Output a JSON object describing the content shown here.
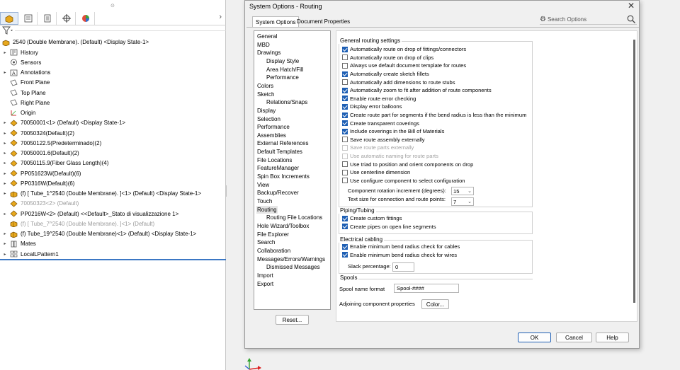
{
  "tree": {
    "root_label": "2540 (Double Membrane). (Default) <Display State-1>",
    "items": [
      {
        "label": "History",
        "expand": "▸",
        "icon": "history-icon",
        "suppressed": false
      },
      {
        "label": "Sensors",
        "expand": "",
        "icon": "sensor-icon",
        "suppressed": false
      },
      {
        "label": "Annotations",
        "expand": "▸",
        "icon": "annotation-icon",
        "suppressed": false
      },
      {
        "label": "Front Plane",
        "expand": "",
        "icon": "plane-icon",
        "suppressed": false
      },
      {
        "label": "Top Plane",
        "expand": "",
        "icon": "plane-icon",
        "suppressed": false
      },
      {
        "label": "Right Plane",
        "expand": "",
        "icon": "plane-icon",
        "suppressed": false
      },
      {
        "label": "Origin",
        "expand": "",
        "icon": "origin-icon",
        "suppressed": false
      },
      {
        "label": "70050001<1> (Default) <Display State-1>",
        "expand": "▸",
        "icon": "part-icon",
        "suppressed": false
      },
      {
        "label": "70050324(Default)(2)",
        "expand": "▸",
        "icon": "part-icon",
        "suppressed": false
      },
      {
        "label": "70050122.5(Predeterminado)(2)",
        "expand": "▸",
        "icon": "part-icon",
        "suppressed": false
      },
      {
        "label": "70050001.6(Default)(2)",
        "expand": "▸",
        "icon": "part-icon",
        "suppressed": false
      },
      {
        "label": "70050115.9(Fiber Glass Length)(4)",
        "expand": "▸",
        "icon": "part-icon",
        "suppressed": false
      },
      {
        "label": "PP051623W(Default)(6)",
        "expand": "▸",
        "icon": "part-icon",
        "suppressed": false
      },
      {
        "label": "PP0316W(Default)(6)",
        "expand": "▸",
        "icon": "part-icon",
        "suppressed": false
      },
      {
        "label": "(f) [ Tube_1^2540 (Double Membrane). ]<1> (Default) <Display State-1>",
        "expand": "▸",
        "icon": "subassembly-icon",
        "suppressed": false
      },
      {
        "label": "70050323<2> (Default)",
        "expand": "",
        "icon": "part-icon",
        "suppressed": true
      },
      {
        "label": "PP0216W<2> (Default) <<Default>_Stato di visualizzazione 1>",
        "expand": "▸",
        "icon": "part-icon",
        "suppressed": false
      },
      {
        "label": "(f) [ Tube_7^2540 (Double Membrane). ]<1> (Default)",
        "expand": "",
        "icon": "subassembly-icon",
        "suppressed": true
      },
      {
        "label": "(f) Tube_19^2540 (Double Membrane)<1> (Default) <Display State-1>",
        "expand": "▸",
        "icon": "subassembly-icon",
        "suppressed": false
      },
      {
        "label": "Mates",
        "expand": "▸",
        "icon": "mates-icon",
        "suppressed": false
      },
      {
        "label": "LocalLPattern1",
        "expand": "▸",
        "icon": "pattern-icon",
        "suppressed": false
      }
    ]
  },
  "dialog": {
    "title": "System Options - Routing",
    "tabs": [
      "System Options",
      "Document Properties"
    ],
    "search_placeholder": "Search Options",
    "categories": [
      {
        "label": "General",
        "sub": false,
        "selected": false
      },
      {
        "label": "MBD",
        "sub": false,
        "selected": false
      },
      {
        "label": "Drawings",
        "sub": false,
        "selected": false
      },
      {
        "label": "Display Style",
        "sub": true,
        "selected": false
      },
      {
        "label": "Area Hatch/Fill",
        "sub": true,
        "selected": false
      },
      {
        "label": "Performance",
        "sub": true,
        "selected": false
      },
      {
        "label": "Colors",
        "sub": false,
        "selected": false
      },
      {
        "label": "Sketch",
        "sub": false,
        "selected": false
      },
      {
        "label": "Relations/Snaps",
        "sub": true,
        "selected": false
      },
      {
        "label": "Display",
        "sub": false,
        "selected": false
      },
      {
        "label": "Selection",
        "sub": false,
        "selected": false
      },
      {
        "label": "Performance",
        "sub": false,
        "selected": false
      },
      {
        "label": "Assemblies",
        "sub": false,
        "selected": false
      },
      {
        "label": "External References",
        "sub": false,
        "selected": false
      },
      {
        "label": "Default Templates",
        "sub": false,
        "selected": false
      },
      {
        "label": "File Locations",
        "sub": false,
        "selected": false
      },
      {
        "label": "FeatureManager",
        "sub": false,
        "selected": false
      },
      {
        "label": "Spin Box Increments",
        "sub": false,
        "selected": false
      },
      {
        "label": "View",
        "sub": false,
        "selected": false
      },
      {
        "label": "Backup/Recover",
        "sub": false,
        "selected": false
      },
      {
        "label": "Touch",
        "sub": false,
        "selected": false
      },
      {
        "label": "Routing",
        "sub": false,
        "selected": true
      },
      {
        "label": "Routing File Locations",
        "sub": true,
        "selected": false
      },
      {
        "label": "Hole Wizard/Toolbox",
        "sub": false,
        "selected": false
      },
      {
        "label": "File Explorer",
        "sub": false,
        "selected": false
      },
      {
        "label": "Search",
        "sub": false,
        "selected": false
      },
      {
        "label": "Collaboration",
        "sub": false,
        "selected": false
      },
      {
        "label": "Messages/Errors/Warnings",
        "sub": false,
        "selected": false
      },
      {
        "label": "Dismissed Messages",
        "sub": true,
        "selected": false
      },
      {
        "label": "Import",
        "sub": false,
        "selected": false
      },
      {
        "label": "Export",
        "sub": false,
        "selected": false
      }
    ],
    "reset_label": "Reset...",
    "general": {
      "title": "General routing settings",
      "options": [
        {
          "label": "Automatically route on drop of fittings/connectors",
          "checked": true,
          "disabled": false
        },
        {
          "label": "Automatically route on drop of clips",
          "checked": false,
          "disabled": false
        },
        {
          "label": "Always use default document template for routes",
          "checked": false,
          "disabled": false
        },
        {
          "label": "Automatically create sketch fillets",
          "checked": true,
          "disabled": false
        },
        {
          "label": "Automatically add dimensions to route stubs",
          "checked": false,
          "disabled": false
        },
        {
          "label": "Automatically zoom to fit after addition of route components",
          "checked": true,
          "disabled": false
        },
        {
          "label": "Enable route error checking",
          "checked": true,
          "disabled": false
        },
        {
          "label": "Display error balloons",
          "checked": true,
          "disabled": false
        },
        {
          "label": "Create route part for segments if the bend radius is less than the minimum",
          "checked": true,
          "disabled": false
        },
        {
          "label": "Create transparent coverings",
          "checked": true,
          "disabled": false
        },
        {
          "label": "Include coverings in the Bill of Materials",
          "checked": true,
          "disabled": false
        },
        {
          "label": "Save route assembly externally",
          "checked": false,
          "disabled": false
        },
        {
          "label": "Save route parts externally",
          "checked": false,
          "disabled": true
        },
        {
          "label": "Use automatic naming for route parts",
          "checked": false,
          "disabled": true
        },
        {
          "label": "Use triad to position and orient components on drop",
          "checked": false,
          "disabled": false
        },
        {
          "label": "Use centerline dimension",
          "checked": false,
          "disabled": false
        },
        {
          "label": "Use configure component to select configuration",
          "checked": false,
          "disabled": false
        }
      ],
      "rotation_label": "Component rotation increment (degrees):",
      "rotation_value": "15",
      "textsize_label": "Text size for connection and route points:",
      "textsize_value": "7"
    },
    "piping": {
      "title": "Piping/Tubing",
      "options": [
        {
          "label": "Create custom fittings",
          "checked": true,
          "disabled": false
        },
        {
          "label": "Create pipes on open line segments",
          "checked": true,
          "disabled": false
        }
      ]
    },
    "electrical": {
      "title": "Electrical cabling",
      "options": [
        {
          "label": "Enable minimum bend radius check for cables",
          "checked": true,
          "disabled": false
        },
        {
          "label": "Enable minimum bend radius check for wires",
          "checked": true,
          "disabled": false
        }
      ],
      "slack_label": "Slack percentage:",
      "slack_value": "0"
    },
    "spools": {
      "title": "Spools",
      "name_format_label": "Spool name format",
      "name_format_value": "Spool-####",
      "adjoining_label": "Adjoining component properties",
      "color_button": "Color..."
    },
    "ok_label": "OK",
    "cancel_label": "Cancel",
    "help_label": "Help"
  },
  "colors": {
    "accent": "#1e5fb4",
    "tree_selection_line": "#3b77c4"
  }
}
